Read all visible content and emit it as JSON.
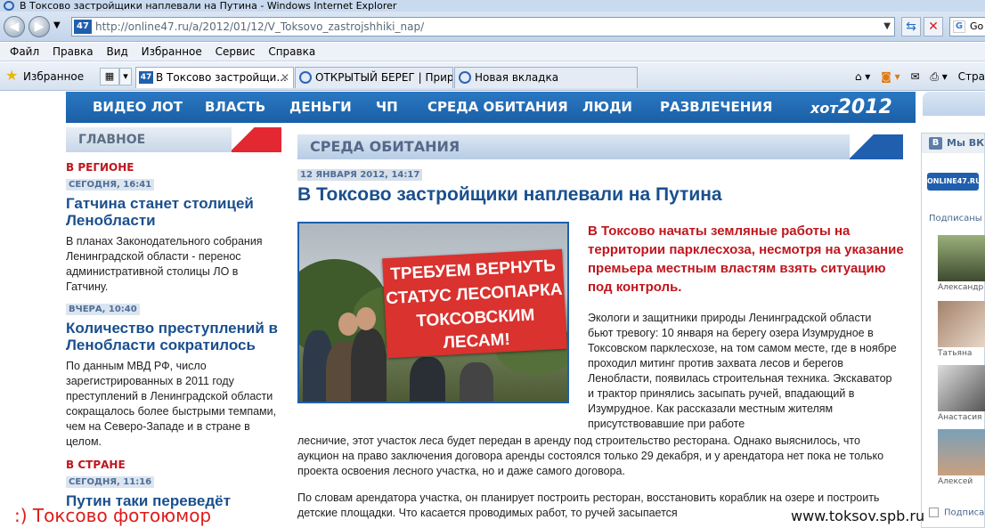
{
  "window": {
    "title": "В Токсово застройщики наплевали на Путина - Windows Internet Explorer",
    "address": "http://online47.ru/a/2012/01/12/V_Toksovo_zastrojshhiki_nap/",
    "site_icon_label": "47",
    "search_engine_label": "Go"
  },
  "menu": [
    "Файл",
    "Правка",
    "Вид",
    "Избранное",
    "Сервис",
    "Справка"
  ],
  "toolbar": {
    "favorites_label": "Избранное",
    "command_partial": "Стра"
  },
  "tabs": [
    {
      "label": "В Токсово застройщи...",
      "active": true
    },
    {
      "label": "ОТКРЫТЫЙ БЕРЕГ | Прир...",
      "active": false
    },
    {
      "label": "Новая вкладка",
      "active": false
    }
  ],
  "nav": {
    "items": [
      "ВИДЕО ЛОТ",
      "ВЛАСТЬ",
      "ДЕНЬГИ",
      "ЧП",
      "СРЕДА ОБИТАНИЯ",
      "ЛЮДИ",
      "РАЗВЛЕЧЕНИЯ"
    ],
    "brand_a": "хот",
    "brand_b": "2012"
  },
  "sidebar": {
    "section_title": "ГЛАВНОЕ",
    "cat1": "В РЕГИОНЕ",
    "news1": {
      "date": "СЕГОДНЯ, 16:41",
      "title": "Гатчина станет столицей Ленобласти",
      "summary": "В планах Законодательного собрания Ленинградской области - перенос административной столицы ЛО в Гатчину."
    },
    "news2": {
      "date": "ВЧЕРА, 10:40",
      "title": "Количество преступлений в Ленобласти сократилось",
      "summary": "По данным МВД РФ, число зарегистрированных в 2011 году преступлений в Ленинградской области сокращалось более быстрыми темпами, чем на Северо-Западе и в стране в целом."
    },
    "cat2": "В СТРАНЕ",
    "news3": {
      "date": "СЕГОДНЯ, 11:16",
      "title": "Путин таки переведёт"
    }
  },
  "article": {
    "section": "СРЕДА ОБИТАНИЯ",
    "date": "12 ЯНВАРЯ 2012, 14:17",
    "title": "В Токсово застройщики наплевали на Путина",
    "banner_lines": [
      "ТРЕБУЕМ ВЕРНУТЬ",
      "СТАТУС ЛЕСОПАРКА",
      "ТОКСОВСКИМ ЛЕСАМ!"
    ],
    "lead": "В Токсово начаты земляные работы на территории парклесхоза, несмотря на указание премьера местным властям взять ситуацию под контроль.",
    "body1": "Экологи и защитники природы Ленинградской области бьют тревогу: 10 января на берегу озера Изумрудное в Токсовском парклесхозе, на том самом месте, где в ноябре проходил митинг против захвата лесов и берегов Ленобласти, появилась строительная техника. Экскаватор и трактор принялись засыпать ручей, впадающий в Изумрудное. Как рассказали местным жителям присутствовавшие при работе",
    "body2": "лесничие, этот участок леса будет передан в аренду под строительство ресторана. Однако выяснилось, что аукцион на право заключения договора аренды состоялся только 29 декабря, и у арендатора нет пока не только проекта освоения лесного участка, но и даже самого договора.",
    "body3": "По словам арендатора участка, он планирует построить ресторан, восстановить кораблик на озере и построить детские площадки. Что касается проводимых работ, то ручей засыпается"
  },
  "vk": {
    "title": "Мы ВКо",
    "logo": "ONLINE47.RU",
    "subscribers_label": "Подписаны",
    "users": [
      "Александр",
      "Татьяна",
      "Анастасия",
      "Алексей"
    ],
    "footer": "Подписа"
  },
  "overlay": {
    "joke": ":) Токсово фотоюмор",
    "site": "www.toksov.spb.ru"
  }
}
